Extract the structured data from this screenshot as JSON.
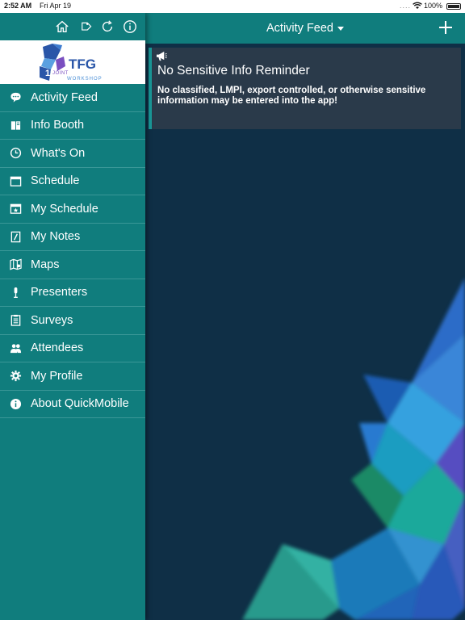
{
  "status_bar": {
    "time": "2:52 AM",
    "date": "Fri Apr 19",
    "signal_dots": "....",
    "battery": "100%"
  },
  "sidebar": {
    "top_icons": [
      "home-icon",
      "tag-icon",
      "refresh-icon",
      "info-icon"
    ],
    "logo": {
      "number": "18",
      "name": "TFG",
      "subtitle": "JOINT",
      "tagline": "WORKSHOP"
    },
    "items": [
      {
        "label": "Activity Feed",
        "icon": "speech-bubble-icon"
      },
      {
        "label": "Info Booth",
        "icon": "book-icon"
      },
      {
        "label": "What's On",
        "icon": "clock-icon"
      },
      {
        "label": "Schedule",
        "icon": "calendar-icon"
      },
      {
        "label": "My Schedule",
        "icon": "calendar-star-icon"
      },
      {
        "label": "My Notes",
        "icon": "notes-icon"
      },
      {
        "label": "Maps",
        "icon": "map-icon"
      },
      {
        "label": "Presenters",
        "icon": "microphone-icon"
      },
      {
        "label": "Surveys",
        "icon": "clipboard-icon"
      },
      {
        "label": "Attendees",
        "icon": "people-icon"
      },
      {
        "label": "My Profile",
        "icon": "gear-icon"
      },
      {
        "label": "About QuickMobile",
        "icon": "info-icon"
      }
    ]
  },
  "header": {
    "title": "Activity Feed",
    "add_icon": "plus-icon"
  },
  "feed": {
    "card": {
      "icon": "bullhorn-icon",
      "title": "No Sensitive Info Reminder",
      "body": "No classified, LMPI, export controlled, or otherwise sensitive information may be entered into the app!"
    }
  },
  "colors": {
    "teal": "#107d7d",
    "background": "#0f2f46",
    "card": "#2a3a4a",
    "card_accent": "#1a9a9a"
  }
}
